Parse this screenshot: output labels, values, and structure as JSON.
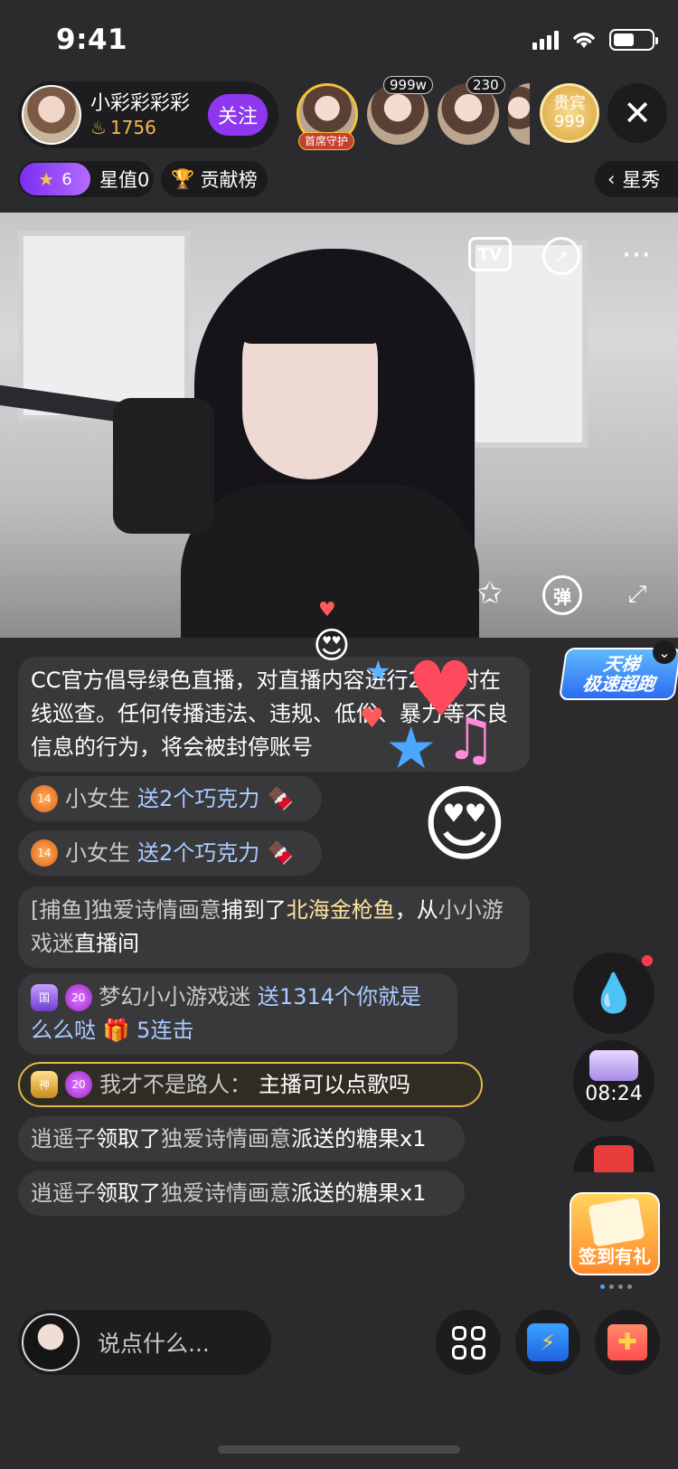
{
  "status_bar": {
    "time": "9:41"
  },
  "anchor": {
    "name": "小彩彩彩彩",
    "heat": "1756",
    "follow_label": "关注"
  },
  "viewers": [
    {
      "badge": "首席守护"
    },
    {
      "badge": "999w"
    },
    {
      "badge": "230"
    }
  ],
  "vip": {
    "line1": "贵宾",
    "line2": "999"
  },
  "top_row": {
    "level": "6",
    "star_value": "星值0",
    "contrib": "贡献榜",
    "xingxiu": "星秀"
  },
  "video_controls": {
    "tv": "TV",
    "danmu": "弹"
  },
  "chat": {
    "notice": "CC官方倡导绿色直播，对直播内容进行24小时在线巡查。任何传播违法、违规、低俗、暴力等不良信息的行为，将会被封停账号",
    "gifts": [
      {
        "level": "14",
        "user": "小女生",
        "text": "送2个巧克力"
      },
      {
        "level": "14",
        "user": "小女生",
        "text": "送2个巧克力"
      }
    ],
    "fish": {
      "prefix": "[捕鱼]",
      "user": "独爱诗情画意",
      "mid": "捕到了",
      "item": "北海金枪鱼",
      "tail": "，从",
      "room": "小小游戏迷",
      "end": "直播间"
    },
    "combo": {
      "badge1": "国",
      "level": "20",
      "user": "梦幻小小游戏迷",
      "text_a": "送1314个你就是",
      "text_b": "么么哒",
      "combo": "5连击"
    },
    "question": {
      "badge1": "神",
      "level": "20",
      "user": "我才不是路人：",
      "text": "主播可以点歌吗"
    },
    "candy": [
      {
        "user": "逍遥子",
        "mid": "领取了",
        "from": "独爱诗情画意",
        "tail": "派送的糖果x1"
      },
      {
        "user": "逍遥子",
        "mid": "领取了",
        "from": "独爱诗情画意",
        "tail": "派送的糖果x1"
      }
    ]
  },
  "right_side": {
    "promo_line1": "天梯",
    "promo_line2": "极速超跑",
    "timer": "08:24",
    "checkin": "签到有礼"
  },
  "bottom": {
    "input_placeholder": "说点什么..."
  },
  "icons": [
    "close-icon",
    "flame-icon",
    "trophy-icon",
    "chevron-left-icon",
    "tv-icon",
    "share-icon",
    "more-icon",
    "pin-icon",
    "danmu-icon",
    "fullscreen-icon",
    "water-drop-icon",
    "treasure-icon",
    "red-packet-icon",
    "grid-icon",
    "shop-icon",
    "gift-icon"
  ],
  "colors": {
    "accent": "#8e37f0",
    "gift_text": "#a9cbff",
    "highlight": "#ffe39a",
    "gold": "#e2b84a",
    "background": "#2b2b2e"
  }
}
